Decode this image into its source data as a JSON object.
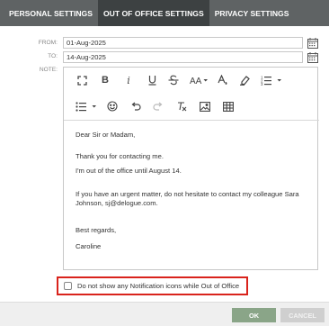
{
  "tabs": [
    {
      "label": "PERSONAL SETTINGS"
    },
    {
      "label": "OUT OF OFFICE SETTINGS",
      "active": true
    },
    {
      "label": "PRIVACY SETTINGS"
    }
  ],
  "form": {
    "from_label": "FROM:",
    "from_value": "01-Aug-2025",
    "to_label": "TO:",
    "to_value": "14-Aug-2025",
    "note_label": "NOTE:"
  },
  "toolbar": {
    "icons": [
      "fullscreen-icon",
      "bold-icon",
      "italic-icon",
      "underline-icon",
      "strikethrough-icon",
      "font-size-icon",
      "font-color-icon",
      "highlight-icon",
      "ordered-list-icon",
      "bullet-list-icon",
      "emoji-icon",
      "undo-icon",
      "redo-icon",
      "clear-format-icon",
      "image-icon",
      "table-icon"
    ]
  },
  "note": {
    "greeting": "Dear Sir or Madam,",
    "line1": "Thank you for contacting me.",
    "line2": "I'm out of the office until August 14.",
    "line3": "If you have an urgent matter, do not hesitate to contact my colleague Sara Johnson, sj@delogue.com.",
    "closing": "Best regards,",
    "signature": "Caroline"
  },
  "checkbox": {
    "label": "Do not show any Notification icons while Out of Office",
    "checked": false
  },
  "buttons": {
    "ok": "OK",
    "cancel": "CANCEL"
  },
  "colors": {
    "tabbar": "#5f6364",
    "active_tab": "#3d4142",
    "ok_button": "#8aa588",
    "highlight_border": "#d9231c"
  }
}
